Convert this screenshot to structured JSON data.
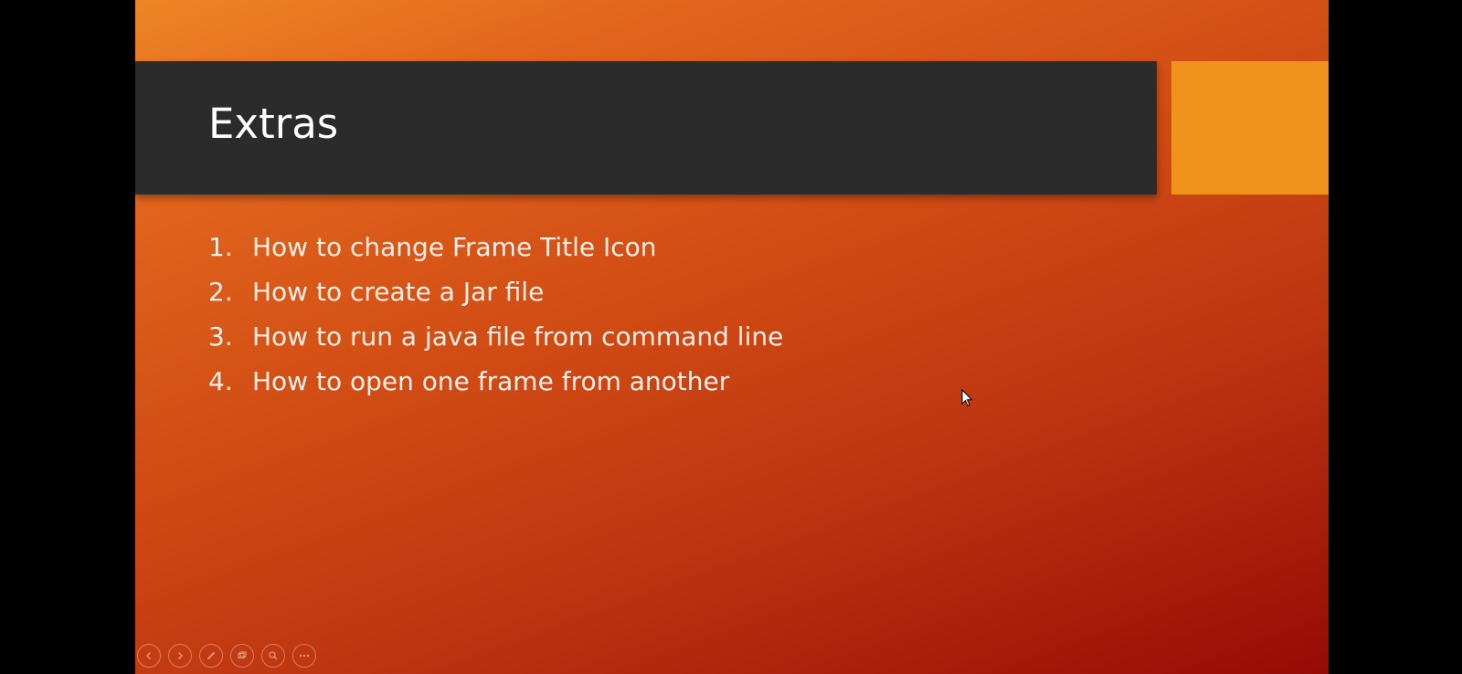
{
  "slide": {
    "title": "Extras",
    "items": [
      {
        "number": "1.",
        "text": "How to change Frame Title Icon"
      },
      {
        "number": "2.",
        "text": "How to create a Jar file"
      },
      {
        "number": "3.",
        "text": "How to run a java file from command line"
      },
      {
        "number": "4.",
        "text": "How to open one frame from another"
      }
    ]
  },
  "colors": {
    "title_bar": "#2b2b2b",
    "accent_box": "#f0931c",
    "gradient_start": "#ee8526",
    "gradient_end": "#960a05"
  },
  "controls": {
    "icons": [
      "previous-icon",
      "next-icon",
      "pen-icon",
      "slides-icon",
      "zoom-icon",
      "more-icon"
    ]
  }
}
